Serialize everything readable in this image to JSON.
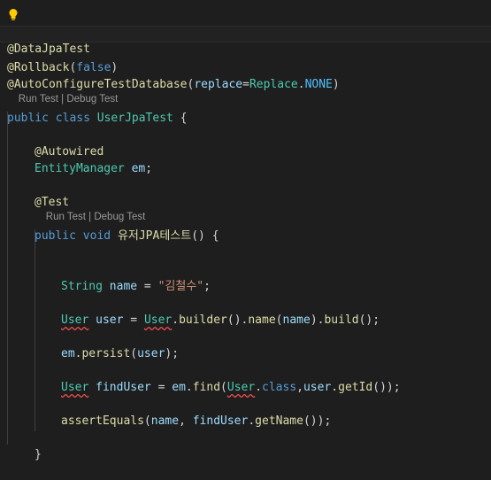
{
  "codelens": {
    "run_test": "Run Test",
    "separator": " | ",
    "debug_test": "Debug Test"
  },
  "code": {
    "line1": {
      "at": "@",
      "name": "DataJpaTest"
    },
    "line2": {
      "at": "@",
      "name": "Rollback",
      "open": "(",
      "value": "false",
      "close": ")"
    },
    "line3": {
      "at": "@",
      "name": "AutoConfigureTestDatabase",
      "open": "(",
      "param": "replace",
      "eq": "=",
      "cls": "Replace",
      "dot": ".",
      "constant": "NONE",
      "close": ")"
    },
    "class_decl": {
      "kw1": "public",
      "kw2": "class",
      "name": "UserJpaTest",
      "brace": " {"
    },
    "autowired": {
      "at": "@",
      "name": "Autowired"
    },
    "field": {
      "type": "EntityManager",
      "name": "em",
      "semi": ";"
    },
    "test_ann": {
      "at": "@",
      "name": "Test"
    },
    "method_decl": {
      "kw1": "public",
      "kw2": "void",
      "name": "유저JPA테스트",
      "rest": "() {"
    },
    "stmt_name": {
      "type": "String",
      "var": "name",
      "eq": " = ",
      "str": "\"김철수\"",
      "semi": ";"
    },
    "stmt_user": {
      "type": "User",
      "var": "user",
      "eq": " = ",
      "cls": "User",
      "chain1": ".",
      "m1": "builder",
      "p1": "().",
      "m2": "name",
      "p2": "(",
      "arg": "name",
      "p3": ").",
      "m3": "build",
      "p4": "();"
    },
    "stmt_persist": {
      "obj": "em",
      "dot": ".",
      "method": "persist",
      "open": "(",
      "arg": "user",
      "close": ");"
    },
    "stmt_find": {
      "type": "User",
      "var": "findUser",
      "eq": " = ",
      "obj": "em",
      "dot": ".",
      "method": "find",
      "open": "(",
      "cls": "User",
      "dot2": ".",
      "kw": "class",
      "comma": ",",
      "arg": "user",
      "dot3": ".",
      "m2": "getId",
      "close": "());"
    },
    "stmt_assert": {
      "method": "assertEquals",
      "open": "(",
      "arg1": "name",
      "comma": ", ",
      "obj": "findUser",
      "dot": ".",
      "m2": "getName",
      "close": "());"
    },
    "closing_brace": "}"
  }
}
